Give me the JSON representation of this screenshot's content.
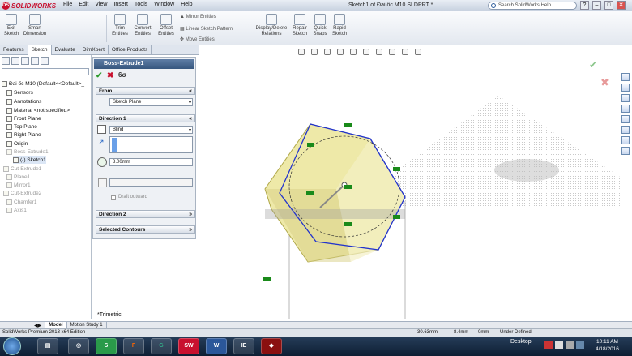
{
  "app": {
    "logo_text": "SOLIDWORKS",
    "logo_mark": "DS"
  },
  "menu": [
    "File",
    "Edit",
    "View",
    "Insert",
    "Tools",
    "Window",
    "Help"
  ],
  "document_title": "Sketch1 of Đai ốc M10.SLDPRT *",
  "search": {
    "placeholder": "Search SolidWorks Help"
  },
  "window_buttons": [
    "?",
    "–",
    "□",
    "✕"
  ],
  "ribbon": {
    "buttons": [
      {
        "label": "Exit Sketch",
        "icon": "exit-sketch-icon"
      },
      {
        "label": "Smart Dimension",
        "icon": "smart-dimension-icon"
      },
      {
        "label": "Trim Entities",
        "icon": "trim-icon"
      },
      {
        "label": "Convert Entities",
        "icon": "convert-icon"
      },
      {
        "label": "Offset Entities",
        "icon": "offset-icon"
      },
      {
        "label": "Display/Delete Relations",
        "icon": "relations-icon"
      },
      {
        "label": "Repair Sketch",
        "icon": "repair-icon"
      },
      {
        "label": "Quick Snaps",
        "icon": "snaps-icon"
      },
      {
        "label": "Rapid Sketch",
        "icon": "rapid-sketch-icon"
      }
    ],
    "small": [
      "Mirror Entities",
      "Linear Sketch Pattern",
      "Move Entities"
    ]
  },
  "tabs": [
    "Features",
    "Sketch",
    "Evaluate",
    "DimXpert",
    "Office Products"
  ],
  "active_tab": "Sketch",
  "tree": {
    "root": "Đai ốc M10  (Default<<Default>_",
    "items": [
      "Sensors",
      "Annotations",
      "Material <not specified>",
      "Front Plane",
      "Top Plane",
      "Right Plane",
      "Origin"
    ],
    "feature": "Boss-Extrude1",
    "sketch": "(-) Sketch1",
    "greyed": [
      "Cut-Extrude1",
      "Plane1",
      "Mirror1",
      "Cut-Extrude2",
      "Chamfer1",
      "Axis1"
    ]
  },
  "property_manager": {
    "title": "Boss-Extrude1",
    "from": {
      "label": "From",
      "value": "Sketch Plane"
    },
    "direction1": {
      "label": "Direction 1",
      "end_condition": "Blind",
      "depth": "8.00mm",
      "draft_label": "Draft outward"
    },
    "direction2": {
      "label": "Direction 2"
    },
    "selected_contours": {
      "label": "Selected Contours"
    }
  },
  "viewport": {
    "view_name": "*Trimetric"
  },
  "bottom_tabs": [
    "Model",
    "Motion Study 1"
  ],
  "status": {
    "edition": "SolidWorks Premium 2013 x64 Edition",
    "x": "30.63mm",
    "y": "8.4mm",
    "z": "0mm",
    "state": "Under Defined"
  },
  "taskbar": {
    "desktop": "Desktop",
    "time": "10:11 AM",
    "date": "4/18/2016",
    "apps": [
      "W",
      "SW",
      "S",
      "F",
      "G",
      "IE"
    ]
  },
  "colors": {
    "accent": "#c8102e",
    "titlebar_pm": "#37577f",
    "sketch": "#2233cc",
    "face": "#e8e29a"
  }
}
